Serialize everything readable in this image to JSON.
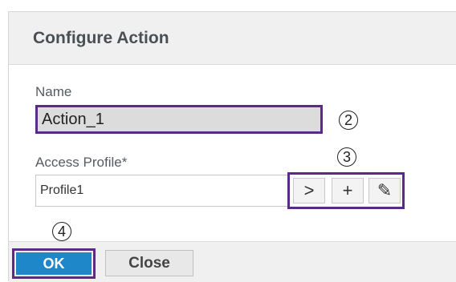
{
  "dialog": {
    "title": "Configure Action",
    "name_label": "Name",
    "name_value": "Action_1",
    "profile_label": "Access Profile*",
    "profile_value": "Profile1",
    "buttons": {
      "select_glyph": ">",
      "add_glyph": "+",
      "edit_glyph": "✎"
    },
    "ok_label": "OK",
    "close_label": "Close"
  },
  "callouts": {
    "two": "2",
    "three": "3",
    "four": "4"
  },
  "colors": {
    "highlight": "#5b2a86",
    "primary_button": "#1d87c9"
  }
}
